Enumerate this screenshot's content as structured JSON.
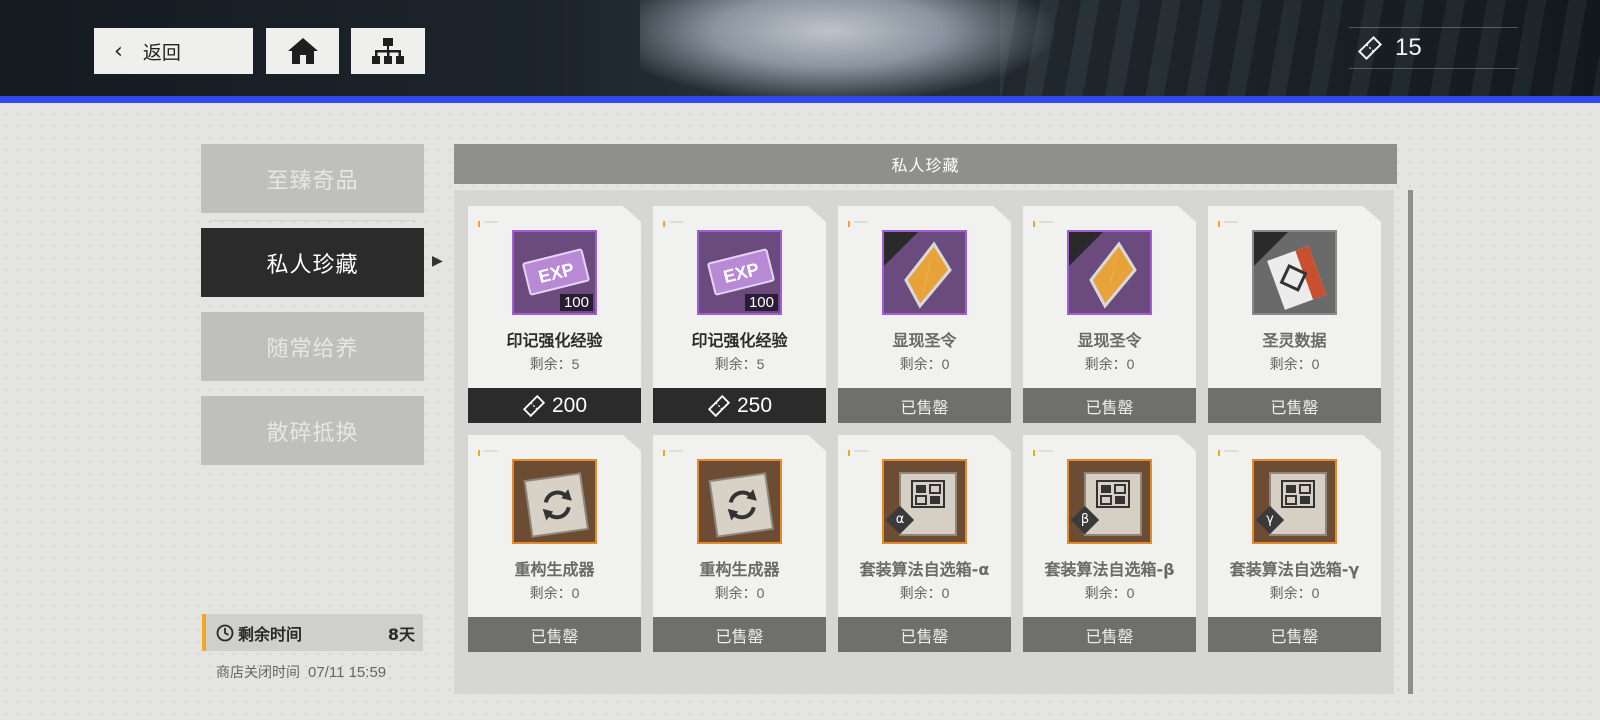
{
  "header": {
    "back_label": "返回",
    "currency_value": "15"
  },
  "tabs": [
    {
      "label": "至臻奇品",
      "active": false
    },
    {
      "label": "私人珍藏",
      "active": true
    },
    {
      "label": "随常给养",
      "active": false
    },
    {
      "label": "散碎抵换",
      "active": false
    }
  ],
  "timer": {
    "label": "剩余时间",
    "value": "8天"
  },
  "shop_close": {
    "label": "商店关闭时间",
    "value": "07/11 15:59"
  },
  "panel": {
    "title": "私人珍藏"
  },
  "remain_label": "剩余：",
  "sold_out_label": "已售罄",
  "items": [
    {
      "name": "印记强化经验",
      "remain": "5",
      "price": "200",
      "sold_out": false,
      "icon": "exp-ticket-icon",
      "qty": "100"
    },
    {
      "name": "印记强化经验",
      "remain": "5",
      "price": "250",
      "sold_out": false,
      "icon": "exp-ticket-icon",
      "qty": "100"
    },
    {
      "name": "显现圣令",
      "remain": "0",
      "sold_out": true,
      "icon": "crystal-icon"
    },
    {
      "name": "显现圣令",
      "remain": "0",
      "sold_out": true,
      "icon": "crystal-icon"
    },
    {
      "name": "圣灵数据",
      "remain": "0",
      "sold_out": true,
      "icon": "data-card-icon"
    },
    {
      "name": "重构生成器",
      "remain": "0",
      "sold_out": true,
      "icon": "regenerate-box-icon"
    },
    {
      "name": "重构生成器",
      "remain": "0",
      "sold_out": true,
      "icon": "regenerate-box-icon"
    },
    {
      "name": "套装算法自选箱-α",
      "remain": "0",
      "sold_out": true,
      "icon": "algorithm-box-icon",
      "greek": "α"
    },
    {
      "name": "套装算法自选箱-β",
      "remain": "0",
      "sold_out": true,
      "icon": "algorithm-box-icon",
      "greek": "β"
    },
    {
      "name": "套装算法自选箱-γ",
      "remain": "0",
      "sold_out": true,
      "icon": "algorithm-box-icon",
      "greek": "γ"
    }
  ],
  "colors": {
    "accent_blue": "#3349e8",
    "timer_accent": "#f2a71e",
    "purple_frame": "#a35cd8",
    "orange_frame": "#e58a2c"
  }
}
